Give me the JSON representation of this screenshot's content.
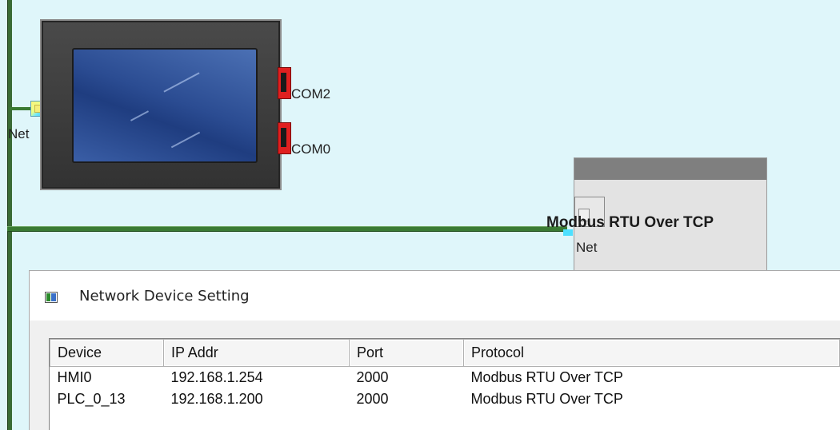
{
  "canvas": {
    "hmi": {
      "net_label": "Net",
      "com_ports": [
        "COM2",
        "COM0"
      ]
    },
    "plc": {
      "title": "Modbus RTU Over TCP",
      "net_label": "Net"
    }
  },
  "dialog": {
    "title": "Network Device Setting",
    "columns": [
      "Device",
      "IP Addr",
      "Port",
      "Protocol"
    ],
    "rows": [
      {
        "device": "HMI0",
        "ip": "192.168.1.254",
        "port": "2000",
        "protocol": "Modbus RTU Over TCP"
      },
      {
        "device": "PLC_0_13",
        "ip": "192.168.1.200",
        "port": "2000",
        "protocol": "Modbus RTU Over TCP"
      }
    ]
  },
  "colors": {
    "canvas_bg": "#dff6fa",
    "bus_green": "#3a7a33",
    "com_port_red": "#e02020"
  }
}
